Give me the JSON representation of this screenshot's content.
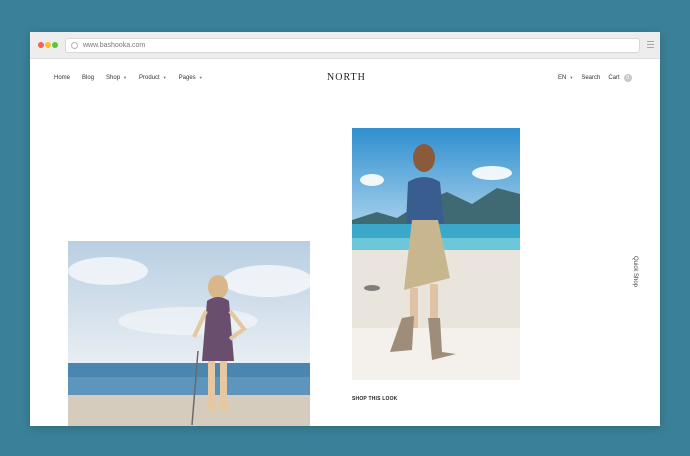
{
  "browser": {
    "url": "www.bashooka.com"
  },
  "nav": {
    "items": [
      {
        "label": "Home",
        "dropdown": false
      },
      {
        "label": "Blog",
        "dropdown": false
      },
      {
        "label": "Shop",
        "dropdown": true
      },
      {
        "label": "Product",
        "dropdown": true
      },
      {
        "label": "Pages",
        "dropdown": true
      }
    ],
    "logo": "NORTH",
    "language": "EN",
    "search": "Search",
    "cart": "Cart",
    "cart_count": "0"
  },
  "main": {
    "shop_this_look": "SHOP THIS LOOK",
    "quick_shop": "Quick Shop"
  },
  "colors": {
    "background": "#3a8098",
    "page": "#ffffff",
    "text": "#222222"
  }
}
